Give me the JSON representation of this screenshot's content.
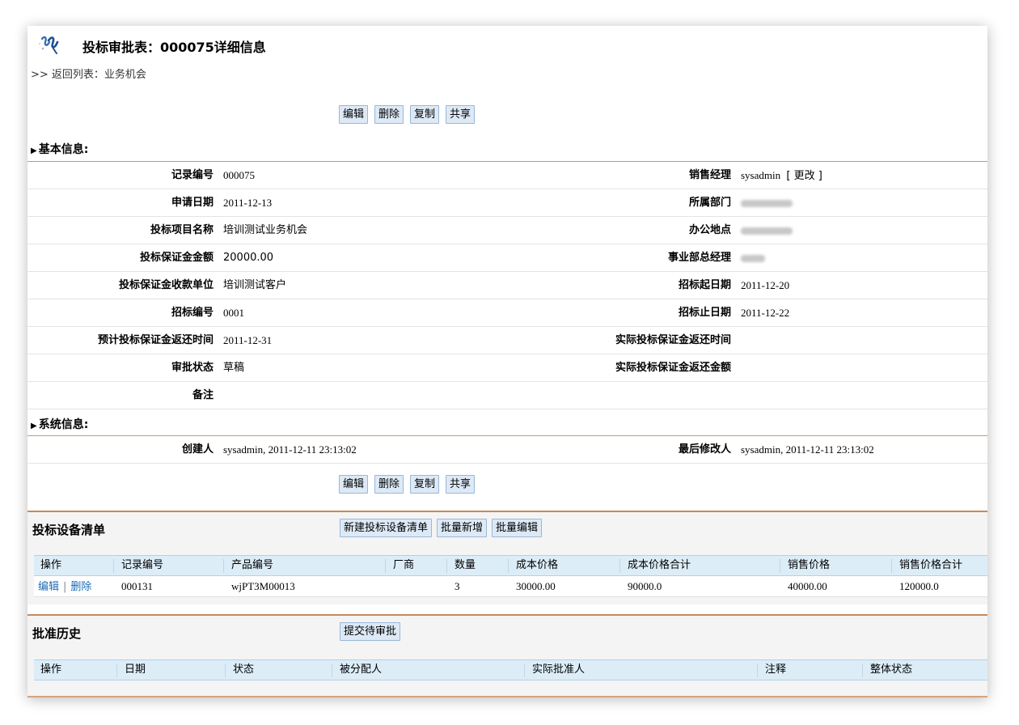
{
  "header": {
    "title": "投标审批表：000075详细信息",
    "back_prefix": ">> ",
    "back_link": "返回列表：业务机会"
  },
  "actions": {
    "edit": "编辑",
    "delete": "删除",
    "copy": "复制",
    "share": "共享"
  },
  "basic_info": {
    "heading": "基本信息:",
    "left_fields": [
      {
        "label": "记录编号",
        "value": "000075"
      },
      {
        "label": "申请日期",
        "value": "2011-12-13"
      },
      {
        "label": "投标项目名称",
        "value": "培训测试业务机会"
      },
      {
        "label": "投标保证金金额",
        "value": "20000.00"
      },
      {
        "label": "投标保证金收款单位",
        "value": "培训测试客户"
      },
      {
        "label": "招标编号",
        "value": "0001"
      },
      {
        "label": "预计投标保证金返还时间",
        "value": "2011-12-31"
      },
      {
        "label": "审批状态",
        "value": "草稿"
      },
      {
        "label": "备注",
        "value": ""
      }
    ],
    "right_fields": [
      {
        "label": "销售经理",
        "value": "sysadmin",
        "link": "[ 更改 ]"
      },
      {
        "label": "所属部门",
        "value": ""
      },
      {
        "label": "办公地点",
        "value": ""
      },
      {
        "label": "事业部总经理",
        "value": ""
      },
      {
        "label": "招标起日期",
        "value": "2011-12-20"
      },
      {
        "label": "招标止日期",
        "value": "2011-12-22"
      },
      {
        "label": "实际投标保证金返还时间",
        "value": ""
      },
      {
        "label": "实际投标保证金返还金额",
        "value": ""
      }
    ]
  },
  "system_info": {
    "heading": "系统信息:",
    "created_label": "创建人",
    "created_value": "sysadmin, 2011-12-11 23:13:02",
    "modified_label": "最后修改人",
    "modified_value": "sysadmin, 2011-12-11 23:13:02"
  },
  "equipment": {
    "title": "投标设备清单",
    "new_button": "新建投标设备清单",
    "bulk_add_button": "批量新增",
    "bulk_edit_button": "批量编辑",
    "columns": [
      "操作",
      "记录编号",
      "产品编号",
      "厂商",
      "数量",
      "成本价格",
      "成本价格合计",
      "销售价格",
      "销售价格合计"
    ],
    "rows": [
      {
        "edit": "编辑",
        "sep": "|",
        "delete": "删除",
        "record_no": "000131",
        "product_no": "wjPT3M00013",
        "vendor": "",
        "qty": "3",
        "cost": "30000.00",
        "cost_total": "90000.0",
        "price": "40000.00",
        "price_total": "120000.0"
      }
    ]
  },
  "approval": {
    "title": "批准历史",
    "submit_button": "提交待审批",
    "columns": [
      "操作",
      "日期",
      "状态",
      "被分配人",
      "实际批准人",
      "注释",
      "整体状态"
    ]
  }
}
